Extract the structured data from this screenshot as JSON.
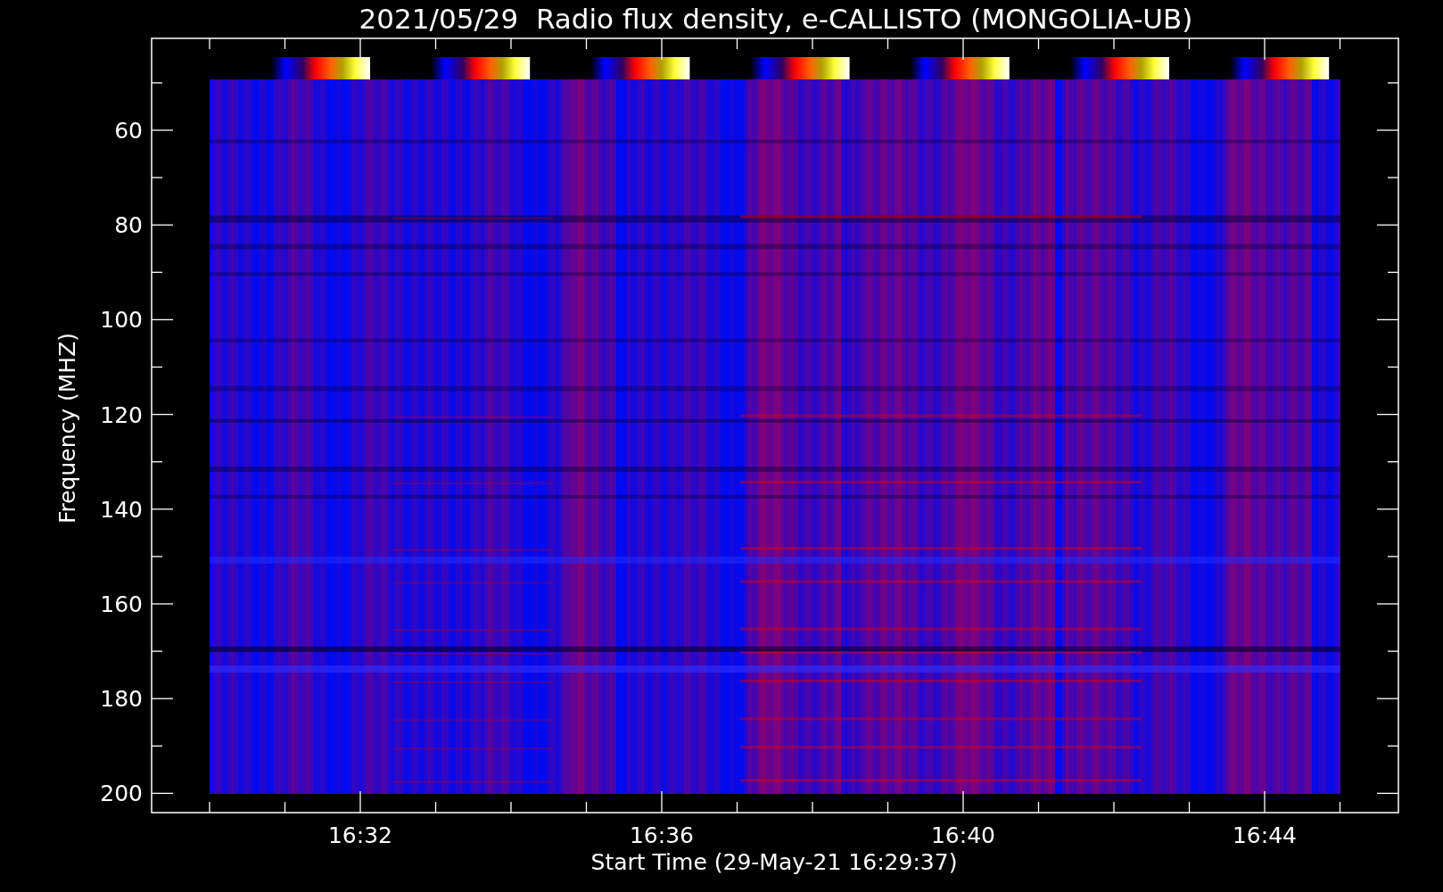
{
  "title": "2021/05/29  Radio flux density, e-CALLISTO (MONGOLIA-UB)",
  "y_axis": {
    "label": "Frequency (MHZ)",
    "ticks": [
      "60",
      "80",
      "100",
      "120",
      "140",
      "160",
      "180",
      "200"
    ]
  },
  "x_axis": {
    "label": "Start Time (29-May-21 16:29:37)",
    "ticks": [
      "16:32",
      "16:36",
      "16:40",
      "16:44"
    ]
  }
}
